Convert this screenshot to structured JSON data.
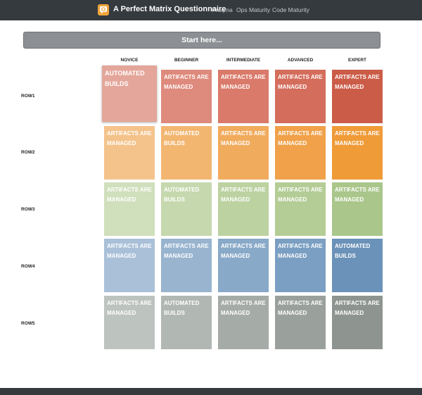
{
  "navbar": {
    "brand": "A Perfect Matrix Questionnaire",
    "links": [
      "Praqma",
      "Ops Maturity",
      "Code Maturity"
    ],
    "logo_icon": "speech-bubble-q-icon"
  },
  "start_button": "Start here...",
  "matrix": {
    "columns": [
      "NOVICE",
      "BEGINNER",
      "INTERMEDIATE",
      "ADVANCED",
      "EXPERT"
    ],
    "rows": [
      {
        "label": "ROW1",
        "cells": [
          "AUTOMATED BUILDS",
          "ARTIFACTS ARE MANAGED",
          "ARTIFACTS ARE MANAGED",
          "ARTIFACTS ARE MANAGED",
          "ARTIFACTS ARE MANAGED"
        ],
        "colors": [
          "#e4a69a",
          "#de8a7c",
          "#d97a6a",
          "#d46d5c",
          "#cb5c48"
        ]
      },
      {
        "label": "ROW2",
        "cells": [
          "ARTIFACTS ARE MANAGED",
          "AUTOMATED BUILDS",
          "ARTIFACTS ARE MANAGED",
          "ARTIFACTS ARE MANAGED",
          "ARTIFACTS ARE MANAGED"
        ],
        "colors": [
          "#f4c38b",
          "#f3b671",
          "#f1ab5d",
          "#f0a149",
          "#ef9b38"
        ]
      },
      {
        "label": "ROW3",
        "cells": [
          "ARTIFACTS ARE MANAGED",
          "AUTOMATED BUILDS",
          "ARTIFACTS ARE MANAGED",
          "ARTIFACTS ARE MANAGED",
          "ARTIFACTS ARE MANAGED"
        ],
        "colors": [
          "#d0dfbc",
          "#c6d8ae",
          "#bcd2a1",
          "#b4cc96",
          "#aac68b"
        ]
      },
      {
        "label": "ROW4",
        "cells": [
          "ARTIFACTS ARE MANAGED",
          "ARTIFACTS ARE MANAGED",
          "ARTIFACTS ARE MANAGED",
          "ARTIFACTS ARE MANAGED",
          "AUTOMATED BUILDS"
        ],
        "colors": [
          "#a9c0d8",
          "#98b4cf",
          "#89a9c8",
          "#7b9fc2",
          "#6b92b8"
        ]
      },
      {
        "label": "ROW5",
        "cells": [
          "ARTIFACTS ARE MANAGED",
          "AUTOMATED BUILDS",
          "ARTIFACTS ARE MANAGED",
          "ARTIFACTS ARE MANAGED",
          "ARTIFACTS ARE MANAGED"
        ],
        "colors": [
          "#bdc3bf",
          "#b1b7b3",
          "#a5aba7",
          "#9aa19c",
          "#8e9591"
        ]
      }
    ],
    "selected": [
      [
        0,
        0
      ]
    ]
  }
}
